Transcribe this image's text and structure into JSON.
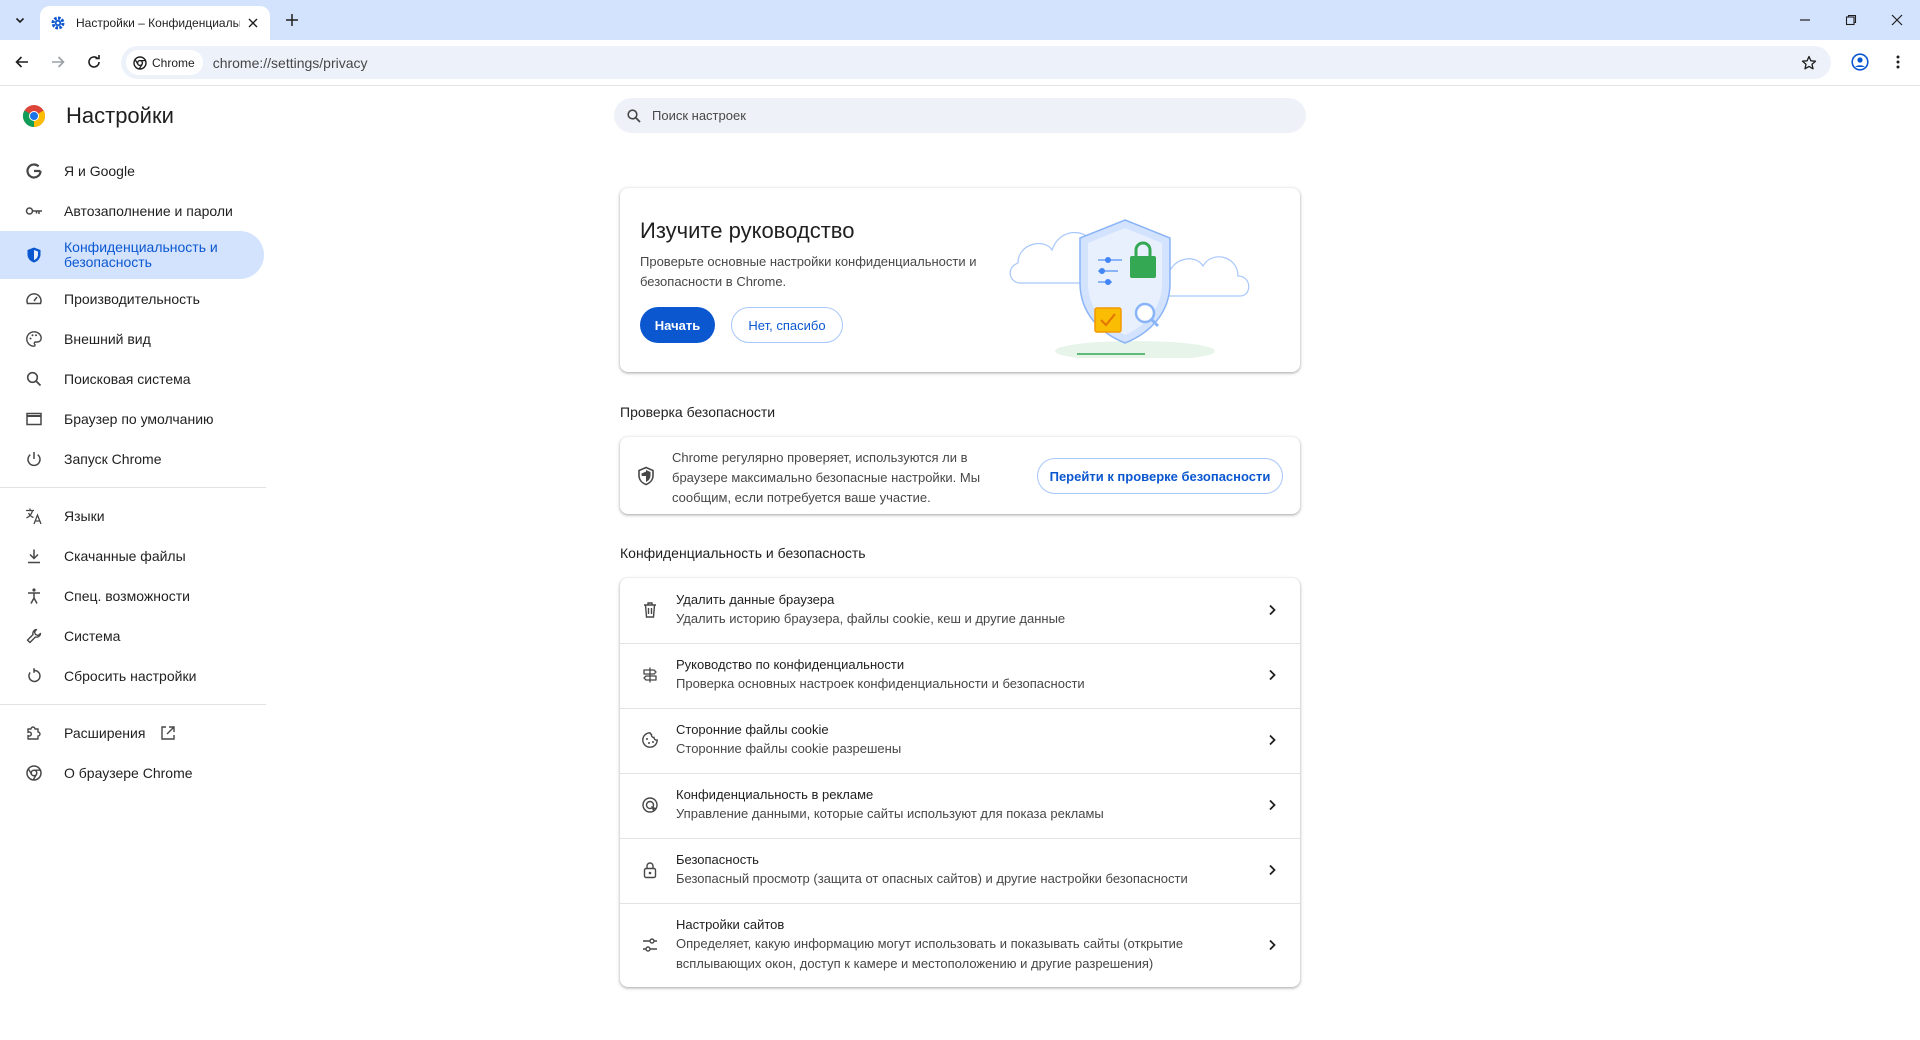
{
  "tab": {
    "title": "Настройки – Конфиденциальность и безопасность"
  },
  "toolbar": {
    "chip_label": "Chrome",
    "url": "chrome://settings/privacy"
  },
  "sidebar": {
    "title": "Настройки",
    "items": [
      {
        "label": "Я и Google",
        "icon": "google-g-icon"
      },
      {
        "label": "Автозаполнение и пароли",
        "icon": "key-icon"
      },
      {
        "label": "Конфиденциальность и безопасность",
        "icon": "shield-icon"
      },
      {
        "label": "Производительность",
        "icon": "speedometer-icon"
      },
      {
        "label": "Внешний вид",
        "icon": "palette-icon"
      },
      {
        "label": "Поисковая система",
        "icon": "search-icon"
      },
      {
        "label": "Браузер по умолчанию",
        "icon": "browser-window-icon"
      },
      {
        "label": "Запуск Chrome",
        "icon": "power-icon"
      },
      {
        "label": "Языки",
        "icon": "translate-icon"
      },
      {
        "label": "Скачанные файлы",
        "icon": "download-icon"
      },
      {
        "label": "Спец. возможности",
        "icon": "accessibility-icon"
      },
      {
        "label": "Система",
        "icon": "wrench-icon"
      },
      {
        "label": "Сбросить настройки",
        "icon": "reset-icon"
      },
      {
        "label": "Расширения",
        "icon": "puzzle-icon"
      },
      {
        "label": "О браузере Chrome",
        "icon": "chrome-icon"
      }
    ]
  },
  "search": {
    "placeholder": "Поиск настроек"
  },
  "guide": {
    "title": "Изучите руководство",
    "description": "Проверьте основные настройки конфиденциальности и безопасности в Chrome.",
    "start_label": "Начать",
    "dismiss_label": "Нет, спасибо"
  },
  "safety_check": {
    "section_title": "Проверка безопасности",
    "text": "Chrome регулярно проверяет, используются ли в браузере максимально безопасные настройки. Мы сообщим, если потребуется ваше участие.",
    "button_label": "Перейти к проверке безопасности"
  },
  "privacy": {
    "section_title": "Конфиденциальность и безопасность",
    "rows": [
      {
        "title": "Удалить данные браузера",
        "subtitle": "Удалить историю браузера, файлы cookie, кеш и другие данные"
      },
      {
        "title": "Руководство по конфиденциальности",
        "subtitle": "Проверка основных настроек конфиденциальности и безопасности"
      },
      {
        "title": "Сторонние файлы cookie",
        "subtitle": "Сторонние файлы cookie разрешены"
      },
      {
        "title": "Конфиденциальность в рекламе",
        "subtitle": "Управление данными, которые сайты используют для показа рекламы"
      },
      {
        "title": "Безопасность",
        "subtitle": "Безопасный просмотр (защита от опасных сайтов) и другие настройки безопасности"
      },
      {
        "title": "Настройки сайтов",
        "subtitle": "Определяет, какую информацию могут использовать и показывать сайты (открытие всплывающих окон, доступ к камере и местоположению и другие разрешения)"
      }
    ]
  },
  "colors": {
    "accent": "#0b57d0",
    "tabstrip": "#d3e3fd",
    "active_nav": "#d3e3fd"
  }
}
